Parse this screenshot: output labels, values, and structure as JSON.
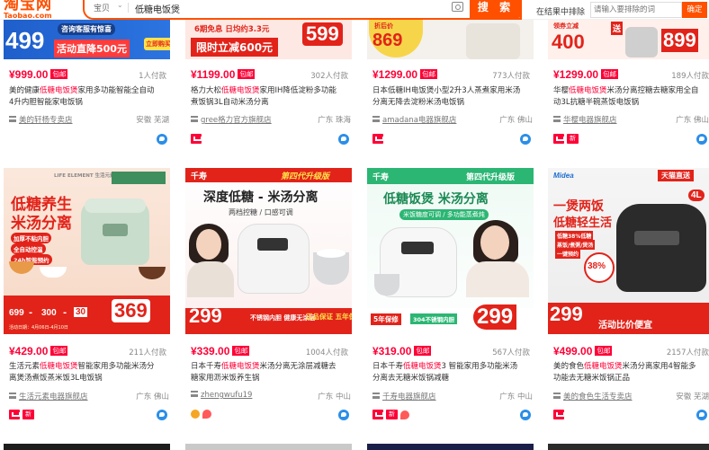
{
  "header": {
    "logo_cn": "淘宝网",
    "logo_en": "Taobao.com",
    "scope": "宝贝",
    "scope_arrow": "⌄",
    "query": "低糖电饭煲",
    "search_label": "搜 索",
    "exclude_label": "在结果中排除",
    "exclude_placeholder": "请输入要排除的词",
    "confirm_label": "确定"
  },
  "top_row": [
    {
      "price": "¥999.00",
      "pay_tag": "包邮",
      "sales": "1人付款",
      "title_pre": "美的健康",
      "title_hl": "低糖电饭煲",
      "title_post": "家用多功能智能全自动4升内胆智能家电饭锅",
      "title_lines": [
        "美的健康低糖电饭煲家用多功能智能全自动",
        "4升内胆智能家电饭锅"
      ],
      "shop": "美的轩杨专卖店",
      "location": "安徽 芜湖",
      "banner_price": "499",
      "banner_text": "咨询客服有惊喜",
      "banner_text2": "活动直降500元",
      "banner_btn": "立即购买"
    },
    {
      "price": "¥1199.00",
      "pay_tag": "包邮",
      "sales": "302人付款",
      "title_lines": [
        "格力大松低糖电饭煲家用IH降低淀粉多功能",
        "煮饭锅3L自动米汤分离"
      ],
      "shop": "gree格力官方旗舰店",
      "location": "广东 珠海",
      "banner_price": "599",
      "banner_text": "6期免息 日均约3.3元",
      "banner_text2": "限时立减600元"
    },
    {
      "price": "¥1299.00",
      "pay_tag": "包邮",
      "sales": "773人付款",
      "title_lines": [
        "日本低糖IH电饭煲小型2升3人蒸煮家用米汤",
        "分离无降去淀粉米汤电饭锅"
      ],
      "shop": "amadana电器旗舰店",
      "location": "广东 佛山",
      "banner_price": "869",
      "banner_text": "折后价"
    },
    {
      "price": "¥1299.00",
      "pay_tag": "包邮",
      "sales": "189人付款",
      "title_lines": [
        "华樱低糖电饭煲米汤分离控糖去糖家用全自",
        "动3L抗糖半碗蒸饭电饭锅"
      ],
      "shop": "华樱电器旗舰店",
      "location": "广东 佛山",
      "banner_price": "899",
      "banner_price2": "400",
      "banner_text": "领券立减",
      "banner_text2": "送"
    }
  ],
  "bottom_row": [
    {
      "price": "¥429.00",
      "pay_tag": "包邮",
      "sales": "211人付款",
      "title_lines": [
        "生活元素低糖电饭煲智能家用多功能米汤分",
        "离煲汤煮饭蒸米饭3L电饭锅"
      ],
      "shop": "生活元素电器旗舰店",
      "location": "广东 佛山",
      "img_title1": "低糖养生",
      "img_title2": "米汤分离",
      "img_brand": "LIFE ELEMENT 生活元素",
      "img_bullets": [
        "加厚不粘内胆",
        "全自动控温",
        "24h智能预约"
      ],
      "img_prices": [
        "699",
        "300",
        "30"
      ],
      "img_final": "369",
      "img_date": "活动日期：4月06日-4月10日"
    },
    {
      "price": "¥339.00",
      "pay_tag": "包邮",
      "sales": "1004人付款",
      "title_lines": [
        "日本千寿低糖电饭煲米汤分离无涂层减糖去",
        "糖家用沥米饭养生锅"
      ],
      "shop": "zhengwufu19",
      "location": "广东 中山",
      "img_brand": "千寿",
      "img_badge": "第四代升级版",
      "img_title": "深度低糖 - 米汤分离",
      "img_sub": "两档控糖 / 口感可调",
      "img_price": "299",
      "img_feat1": "不锈钢内胆 健康无涂层",
      "img_feat2": "正品保证 五年保修",
      "img_date": "到手价"
    },
    {
      "price": "¥319.00",
      "pay_tag": "包邮",
      "sales": "567人付款",
      "title_lines": [
        "日本千寿低糖电饭煲3 智能家用多功能米汤",
        "分离去无糖米饭锅减糖"
      ],
      "shop": "千寿电器旗舰店",
      "location": "广东 中山",
      "img_brand": "千寿",
      "img_badge": "第四代升级版",
      "img_title": "低糖饭煲 米汤分离",
      "img_sub": "米饭糖度可调 / 多功能蒸煮炖",
      "img_price": "299",
      "img_feat1": "5年保修",
      "img_feat2": "304不锈钢内胆",
      "img_date": "到手价"
    },
    {
      "price": "¥499.00",
      "pay_tag": "包邮",
      "sales": "2157人付款",
      "title_lines": [
        "美的食色低糖电饭煲米汤分离家用4智能多",
        "功能去无糖米饭锅正品"
      ],
      "shop": "美的食色生活专卖店",
      "location": "安徽 芜湖",
      "img_brand": "Midea",
      "img_badge": "天猫直送",
      "img_title1": "一煲两饭",
      "img_title2": "低糖轻生活",
      "img_pct": "38%",
      "img_price": "299",
      "img_cap": "4L",
      "img_bullets": [
        "低糖38%低糖",
        "蒸饭/煮粥/煲汤",
        "一键预约"
      ],
      "img_footer": "活动比价便宜"
    }
  ]
}
